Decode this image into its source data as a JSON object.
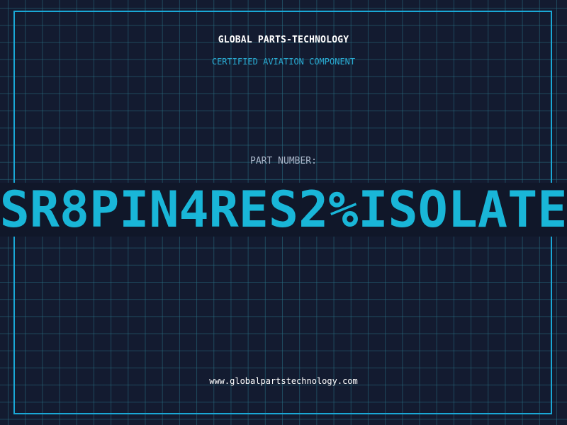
{
  "header": {
    "company": "GLOBAL PARTS-TECHNOLOGY",
    "subtitle": "CERTIFIED AVIATION COMPONENT"
  },
  "part": {
    "label": "PART NUMBER:",
    "number": "SR8PIN4RES2%ISOLATE"
  },
  "footer": {
    "website": "www.globalpartstechnology.com"
  },
  "colors": {
    "background": "#131b30",
    "accent": "#19b6d8",
    "grid": "#286e82"
  }
}
